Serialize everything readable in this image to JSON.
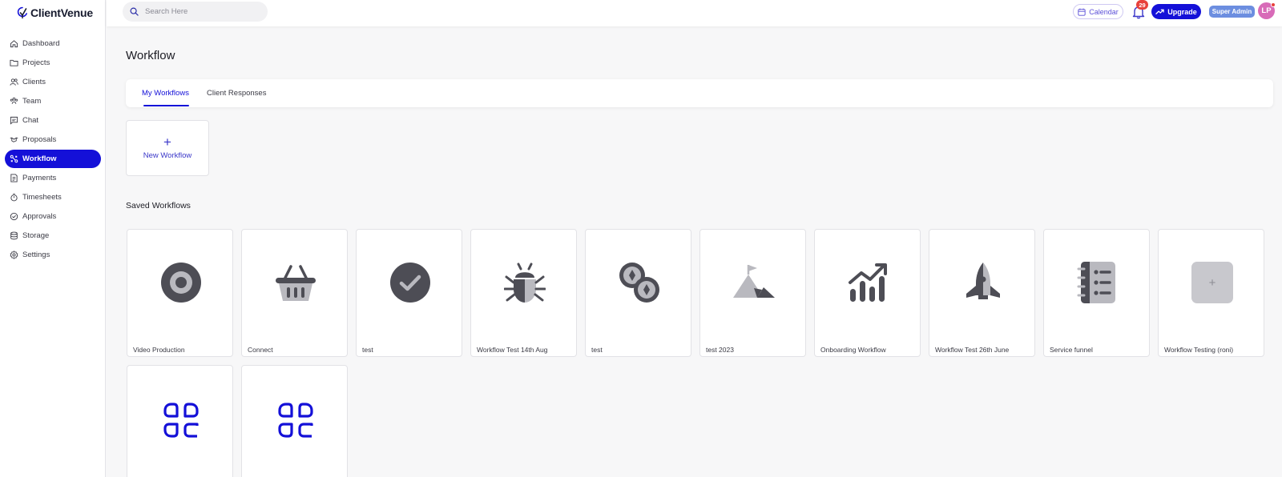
{
  "app": {
    "name": "ClientVenue"
  },
  "sidebar": {
    "items": [
      {
        "label": "Dashboard",
        "icon": "home-icon"
      },
      {
        "label": "Projects",
        "icon": "folder-icon"
      },
      {
        "label": "Clients",
        "icon": "clients-icon"
      },
      {
        "label": "Team",
        "icon": "team-icon"
      },
      {
        "label": "Chat",
        "icon": "chat-icon"
      },
      {
        "label": "Proposals",
        "icon": "handshake-icon"
      },
      {
        "label": "Workflow",
        "icon": "workflow-icon",
        "active": true
      },
      {
        "label": "Payments",
        "icon": "invoice-icon"
      },
      {
        "label": "Timesheets",
        "icon": "stopwatch-icon"
      },
      {
        "label": "Approvals",
        "icon": "approval-icon"
      },
      {
        "label": "Storage",
        "icon": "database-icon"
      },
      {
        "label": "Settings",
        "icon": "gear-icon"
      }
    ]
  },
  "topbar": {
    "search_placeholder": "Search Here",
    "calendar_label": "Calendar",
    "notification_count": "29",
    "upgrade_label": "Upgrade",
    "role_badge": "Super Admin",
    "avatar_initials": "LP"
  },
  "main": {
    "title": "Workflow",
    "tabs": [
      {
        "label": "My Workflows",
        "active": true
      },
      {
        "label": "Client Responses",
        "active": false
      }
    ],
    "new_workflow": {
      "plus": "+",
      "label": "New Workflow"
    },
    "saved_title": "Saved Workflows",
    "workflows": [
      {
        "name": "Video Production",
        "icon": "target-icon"
      },
      {
        "name": "Connect",
        "icon": "basket-icon"
      },
      {
        "name": "test",
        "icon": "check-circle-icon"
      },
      {
        "name": "Workflow Test 14th Aug",
        "icon": "bug-icon"
      },
      {
        "name": "test",
        "icon": "coins-icon"
      },
      {
        "name": "test 2023",
        "icon": "mountain-flag-icon"
      },
      {
        "name": "Onboarding Workflow",
        "icon": "growth-chart-icon"
      },
      {
        "name": "Workflow Test 26th June",
        "icon": "rocket-icon"
      },
      {
        "name": "Service funnel",
        "icon": "notebook-icon"
      },
      {
        "name": "Workflow Testing (roni)",
        "icon": "plus-square-icon",
        "plus": "+"
      },
      {
        "name": "",
        "icon": "command-icon"
      },
      {
        "name": "",
        "icon": "command-icon"
      }
    ]
  },
  "colors": {
    "accent": "#1410d8",
    "icon_dark": "#4d4d55",
    "icon_light": "#b9b9bf",
    "badge_red": "#e8413b",
    "admin_badge": "#6c8ee0",
    "avatar": "#d86bb8"
  }
}
